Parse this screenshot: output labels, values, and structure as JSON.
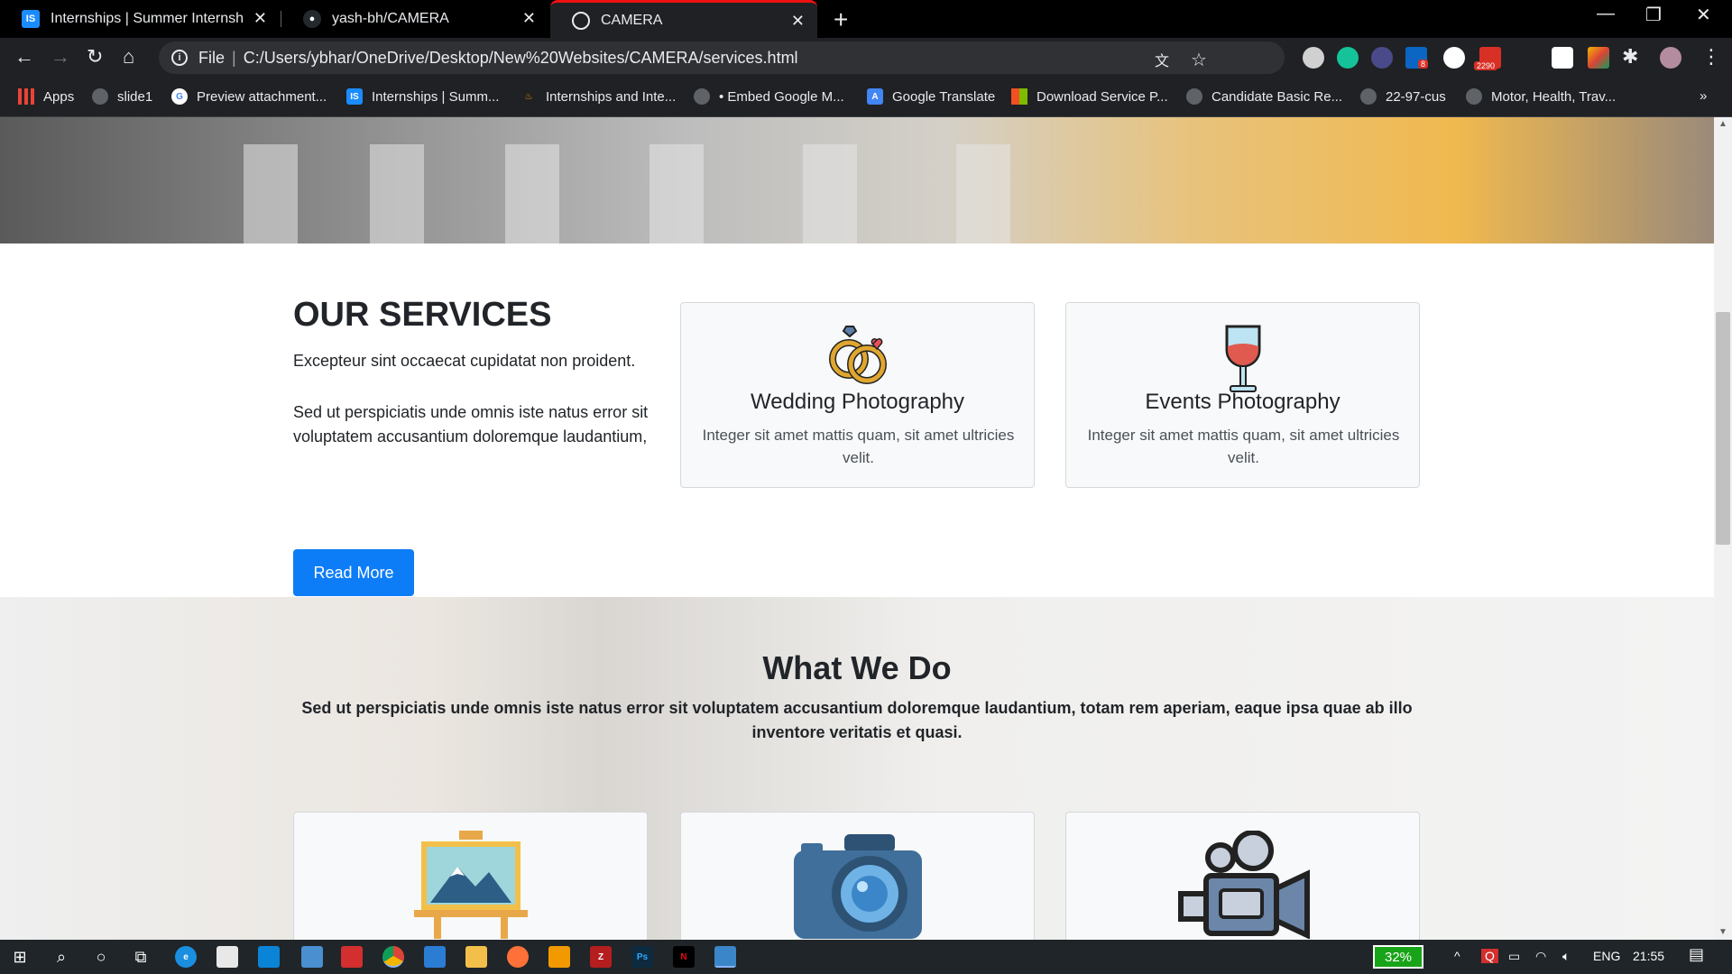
{
  "browser": {
    "tabs": [
      {
        "title": "Internships | Summer Internship",
        "favicon": "IS",
        "active": false
      },
      {
        "title": "yash-bh/CAMERA",
        "favicon": "github-icon",
        "active": false
      },
      {
        "title": "CAMERA",
        "favicon": "globe-icon",
        "active": true
      }
    ],
    "omnibox": {
      "scheme": "File",
      "url": "C:/Users/ybhar/OneDrive/Desktop/New%20Websites/CAMERA/services.html"
    },
    "extension_badges": {
      "linkedin": "8",
      "mail": "2290"
    },
    "bookmarks": [
      {
        "label": "Apps",
        "icon": "apps-grid-icon"
      },
      {
        "label": "slide1",
        "icon": "globe-icon"
      },
      {
        "label": "Preview attachment...",
        "icon": "google-icon"
      },
      {
        "label": "Internships | Summ...",
        "icon": "IS"
      },
      {
        "label": "Internships and Inte...",
        "icon": "flame-icon"
      },
      {
        "label": "• Embed Google M...",
        "icon": "globe-icon"
      },
      {
        "label": "Google Translate",
        "icon": "translate-icon"
      },
      {
        "label": "Download Service P...",
        "icon": "microsoft-icon"
      },
      {
        "label": "Candidate Basic Re...",
        "icon": "globe-icon"
      },
      {
        "label": "22-97-cus",
        "icon": "globe-icon"
      },
      {
        "label": "Motor, Health, Trav...",
        "icon": "globe-icon"
      }
    ]
  },
  "page": {
    "services": {
      "heading": "OUR SERVICES",
      "intro": "Excepteur sint occaecat cupidatat non proident.",
      "body": "Sed ut perspiciatis unde omnis iste natus error sit voluptatem accusantium doloremque laudantium,",
      "button": "Read More",
      "cards": [
        {
          "title": "Wedding Photography",
          "text": "Integer sit amet mattis quam, sit amet ultricies velit.",
          "icon": "wedding-rings-icon"
        },
        {
          "title": "Events Photography",
          "text": "Integer sit amet mattis quam, sit amet ultricies velit.",
          "icon": "wine-glass-icon"
        }
      ]
    },
    "whatwedo": {
      "heading": "What We Do",
      "lead": "Sed ut perspiciatis unde omnis iste natus error sit voluptatem accusantium doloremque laudantium, totam rem aperiam, eaque ipsa quae ab illo inventore veritatis et quasi.",
      "cards": [
        {
          "icon": "easel-painting-icon"
        },
        {
          "icon": "camera-icon"
        },
        {
          "icon": "video-camera-icon"
        }
      ]
    }
  },
  "taskbar": {
    "battery": "32%",
    "language": "ENG",
    "time": "21:55"
  },
  "colors": {
    "primary": "#0d7df7",
    "active_tab_accent": "#ee1111",
    "battery": "#18a418"
  }
}
